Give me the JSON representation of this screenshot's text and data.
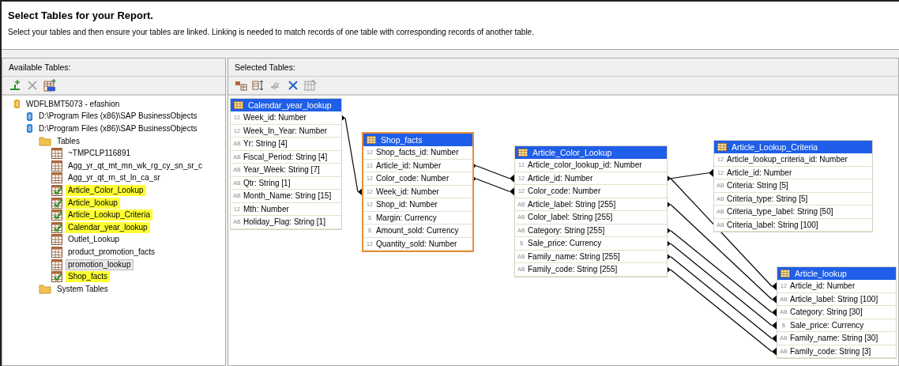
{
  "header": {
    "title": "Select Tables for your Report.",
    "description": "Select your tables and then ensure your tables are linked. Linking is needed to match records of one table with corresponding records of another table."
  },
  "available": {
    "title": "Available Tables:",
    "tree": [
      {
        "kind": "server",
        "label": "WDFLBMT5073 - efashion",
        "added": false,
        "selected": false,
        "children": [
          {
            "kind": "database",
            "label": "D:\\Program Files (x86)\\SAP BusinessObjects",
            "added": false,
            "selected": false
          },
          {
            "kind": "database",
            "label": "D:\\Program Files (x86)\\SAP BusinessObjects",
            "added": false,
            "selected": false,
            "children": [
              {
                "kind": "folder",
                "label": "Tables",
                "added": false,
                "selected": false,
                "children": [
                  {
                    "kind": "table",
                    "label": "~TMPCLP116891",
                    "added": false,
                    "selected": false
                  },
                  {
                    "kind": "table",
                    "label": "Agg_yr_qt_mt_mn_wk_rg_cy_sn_sr_c",
                    "added": false,
                    "selected": false
                  },
                  {
                    "kind": "table",
                    "label": "Agg_yr_qt_rn_st_ln_ca_sr",
                    "added": false,
                    "selected": false
                  },
                  {
                    "kind": "table",
                    "label": "Article_Color_Lookup",
                    "added": true,
                    "selected": false
                  },
                  {
                    "kind": "table",
                    "label": "Article_lookup",
                    "added": true,
                    "selected": false
                  },
                  {
                    "kind": "table",
                    "label": "Article_Lookup_Criteria",
                    "added": true,
                    "selected": false
                  },
                  {
                    "kind": "table",
                    "label": "Calendar_year_lookup",
                    "added": true,
                    "selected": false
                  },
                  {
                    "kind": "table",
                    "label": "Outlet_Lookup",
                    "added": false,
                    "selected": false
                  },
                  {
                    "kind": "table",
                    "label": "product_promotion_facts",
                    "added": false,
                    "selected": false
                  },
                  {
                    "kind": "table",
                    "label": "promotion_lookup",
                    "added": false,
                    "selected": true
                  },
                  {
                    "kind": "table",
                    "label": "Shop_facts",
                    "added": true,
                    "selected": false
                  }
                ]
              },
              {
                "kind": "folder",
                "label": "System Tables",
                "added": false,
                "selected": false
              }
            ]
          }
        ]
      }
    ]
  },
  "selected_tables": {
    "title": "Selected Tables:",
    "tables": [
      {
        "name": "Calendar_year_lookup",
        "selected": false,
        "fields": [
          {
            "type": "12",
            "label": "Week_id: Number"
          },
          {
            "type": "12",
            "label": "Week_In_Year: Number"
          },
          {
            "type": "AB",
            "label": "Yr: String [4]"
          },
          {
            "type": "AB",
            "label": "Fiscal_Period: String [4]"
          },
          {
            "type": "AB",
            "label": "Year_Week: String [7]"
          },
          {
            "type": "AB",
            "label": "Qtr: String [1]"
          },
          {
            "type": "AB",
            "label": "Month_Name: String [15]"
          },
          {
            "type": "12",
            "label": "Mth: Number"
          },
          {
            "type": "AB",
            "label": "Holiday_Flag: String [1]"
          }
        ]
      },
      {
        "name": "Shop_facts",
        "selected": true,
        "fields": [
          {
            "type": "12",
            "label": "Shop_facts_id: Number"
          },
          {
            "type": "12",
            "label": "Article_id: Number"
          },
          {
            "type": "12",
            "label": "Color_code: Number"
          },
          {
            "type": "12",
            "label": "Week_id: Number"
          },
          {
            "type": "12",
            "label": "Shop_id: Number"
          },
          {
            "type": "$",
            "label": "Margin: Currency"
          },
          {
            "type": "$",
            "label": "Amount_sold: Currency"
          },
          {
            "type": "12",
            "label": "Quantity_sold: Number"
          }
        ]
      },
      {
        "name": "Article_Color_Lookup",
        "selected": false,
        "fields": [
          {
            "type": "12",
            "label": "Article_color_lookup_id: Number"
          },
          {
            "type": "12",
            "label": "Article_id: Number"
          },
          {
            "type": "12",
            "label": "Color_code: Number"
          },
          {
            "type": "AB",
            "label": "Article_label: String [255]"
          },
          {
            "type": "AB",
            "label": "Color_label: String [255]"
          },
          {
            "type": "AB",
            "label": "Category: String [255]"
          },
          {
            "type": "$",
            "label": "Sale_price: Currency"
          },
          {
            "type": "AB",
            "label": "Family_name: String [255]"
          },
          {
            "type": "AB",
            "label": "Family_code: String [255]"
          }
        ]
      },
      {
        "name": "Article_Lookup_Criteria",
        "selected": false,
        "fields": [
          {
            "type": "12",
            "label": "Article_lookup_criteria_id: Number"
          },
          {
            "type": "12",
            "label": "Article_id: Number"
          },
          {
            "type": "AB",
            "label": "Criteria: String [5]"
          },
          {
            "type": "AB",
            "label": "Criteria_type: String [5]"
          },
          {
            "type": "AB",
            "label": "Criteria_type_label: String [50]"
          },
          {
            "type": "AB",
            "label": "Criteria_label: String [100]"
          }
        ]
      },
      {
        "name": "Article_lookup",
        "selected": false,
        "fields": [
          {
            "type": "12",
            "label": "Article_id: Number"
          },
          {
            "type": "AB",
            "label": "Article_label: String [100]"
          },
          {
            "type": "AB",
            "label": "Category: String [30]"
          },
          {
            "type": "$",
            "label": "Sale_price: Currency"
          },
          {
            "type": "AB",
            "label": "Family_name: String [30]"
          },
          {
            "type": "AB",
            "label": "Family_code: String [3]"
          }
        ]
      }
    ]
  }
}
